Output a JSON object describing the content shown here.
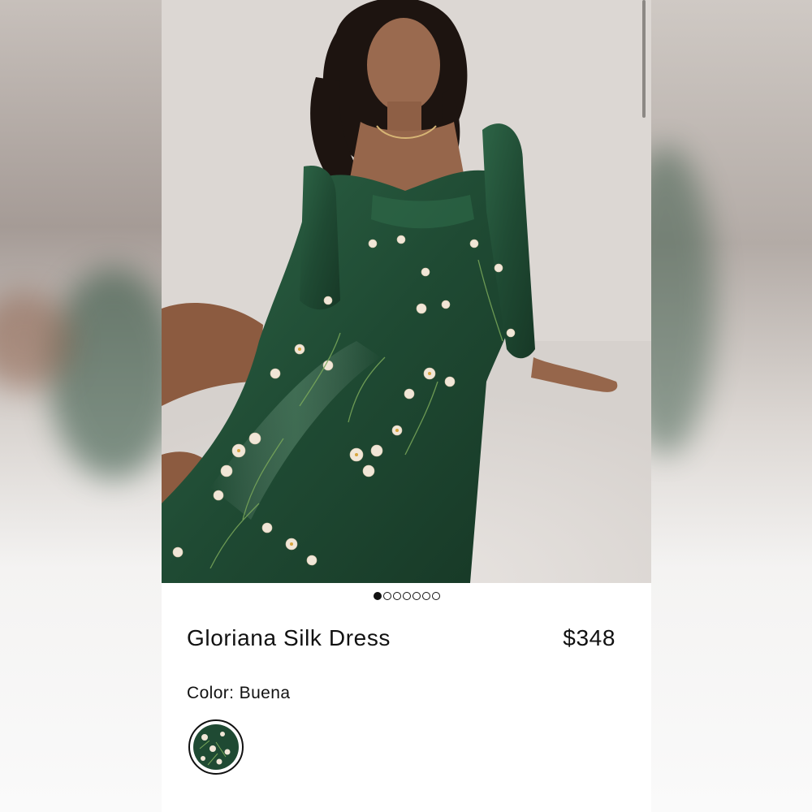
{
  "product": {
    "name": "Gloriana Silk Dress",
    "price": "$348",
    "color_label": "Color:",
    "color_value": "Buena"
  },
  "gallery": {
    "image_count": 7,
    "active_index": 0,
    "image_icon": "product-photo"
  },
  "colors": {
    "dress_green": "#1f4a33",
    "background": "#ffffff",
    "text": "#111111"
  }
}
